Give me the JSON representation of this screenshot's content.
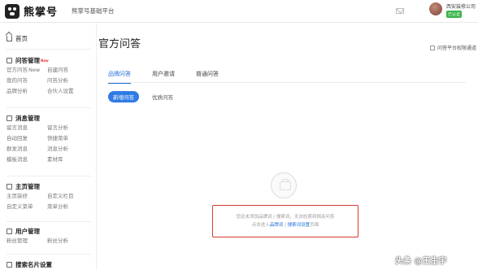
{
  "topbar": {
    "logo_text": "熊掌号",
    "platform": "熊掌号基础平台",
    "account_name": "西安装修公司",
    "account_badge": "已认证"
  },
  "sidebar": {
    "home": "首页",
    "sections": [
      {
        "title": "问答管理",
        "new": "New",
        "items": [
          "官方问答",
          "自建问答",
          "我的问答",
          "问答分析",
          "品牌分析",
          "合伙人设置"
        ],
        "new_item": "New"
      },
      {
        "title": "消息管理",
        "items": [
          "留言消息",
          "留言分析",
          "自动回复",
          "快捷菜单",
          "群发消息",
          "消息分析",
          "模板消息",
          "素材库"
        ]
      },
      {
        "title": "主页管理",
        "items": [
          "主页装修",
          "自定义栏目",
          "自定义菜单",
          "菜单分析"
        ]
      },
      {
        "title": "用户管理",
        "items": [
          "粉丝管理",
          "粉丝分析"
        ]
      },
      {
        "title": "搜索名片设置",
        "items": []
      }
    ]
  },
  "main": {
    "title": "官方问答",
    "settings_label": "问答平台权限通道",
    "tabs": [
      "品牌问答",
      "用户邀请",
      "普通问答"
    ],
    "subtabs": [
      "新增问答",
      "优质问答"
    ],
    "empty_line1": "您还未添加品牌词 / 搜索词，无法检索到相关问答",
    "empty_line2_prefix": "点击进入",
    "empty_link1": "品牌词",
    "empty_sep": " / ",
    "empty_link2": "搜索词设置",
    "empty_line2_suffix": "页面"
  },
  "watermark": "头条 @王生宇"
}
